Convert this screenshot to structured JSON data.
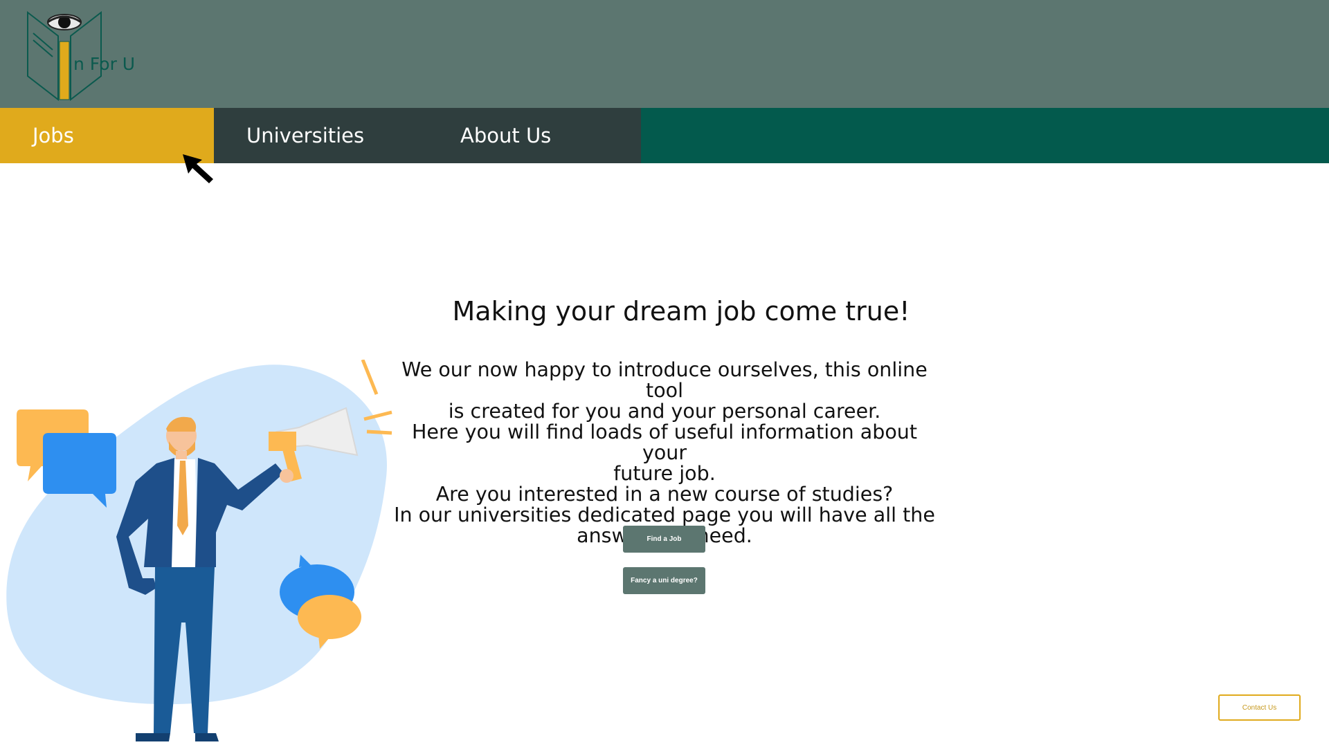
{
  "brand": {
    "logo_text": "n For U"
  },
  "nav": {
    "items": [
      {
        "label": "Jobs",
        "active": true
      },
      {
        "label": "Universities",
        "active": false
      },
      {
        "label": "About Us",
        "active": false
      }
    ]
  },
  "hero": {
    "title": "Making your dream job come true!",
    "lines": [
      "We our now happy to introduce ourselves, this online tool",
      "is created for you and your personal career.",
      "Here you will find loads of useful information about your",
      "future job.",
      "Are you interested in a new course of studies?",
      "In our universities dedicated page you will have all the",
      "answer you need."
    ]
  },
  "buttons": {
    "find_job": "Find a Job",
    "uni_degree": "Fancy a uni degree?",
    "contact": "Contact Us"
  },
  "colors": {
    "header": "#5c7670",
    "nav": "#035a4d",
    "nav_dark": "#2f3e3e",
    "accent": "#e0aa1c"
  }
}
